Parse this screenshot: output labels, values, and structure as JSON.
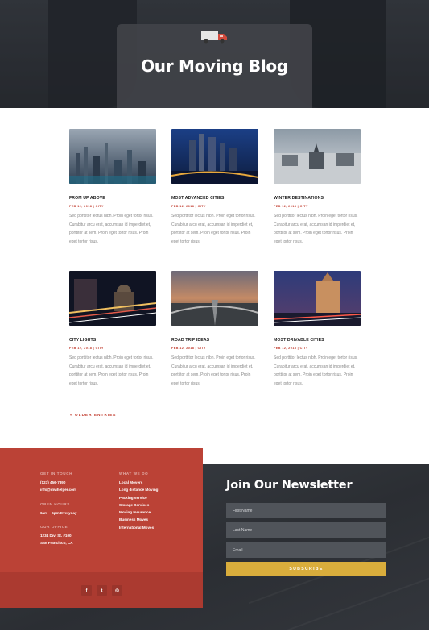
{
  "hero": {
    "title": "Our Moving Blog",
    "icon": "truck-icon"
  },
  "posts": [
    {
      "title": "FROM UP ABOVE",
      "meta": "FEB 12, 2018 | CITY",
      "excerpt": "Sed porttitor lectus nibh. Proin eget tortor risus. Curabitur arcu erat, accumsan id imperdiet et, porttitor at sem. Proin eget tortor risus. Proin eget tortor risus."
    },
    {
      "title": "MOST ADVANCED CITIES",
      "meta": "FEB 12, 2018 | CITY",
      "excerpt": "Sed porttitor lectus nibh. Proin eget tortor risus. Curabitur arcu erat, accumsan id imperdiet et, porttitor at sem. Proin eget tortor risus. Proin eget tortor risus."
    },
    {
      "title": "WINTER DESTINATIONS",
      "meta": "FEB 12, 2018 | CITY",
      "excerpt": "Sed porttitor lectus nibh. Proin eget tortor risus. Curabitur arcu erat, accumsan id imperdiet et, porttitor at sem. Proin eget tortor risus. Proin eget tortor risus."
    },
    {
      "title": "CITY LIGHTS",
      "meta": "FEB 12, 2018 | CITY",
      "excerpt": "Sed porttitor lectus nibh. Proin eget tortor risus. Curabitur arcu erat, accumsan id imperdiet et, porttitor at sem. Proin eget tortor risus. Proin eget tortor risus."
    },
    {
      "title": "ROAD TRIP IDEAS",
      "meta": "FEB 12, 2018 | CITY",
      "excerpt": "Sed porttitor lectus nibh. Proin eget tortor risus. Curabitur arcu erat, accumsan id imperdiet et, porttitor at sem. Proin eget tortor risus. Proin eget tortor risus."
    },
    {
      "title": "MOST DRIVABLE CITIES",
      "meta": "FEB 12, 2018 | CITY",
      "excerpt": "Sed porttitor lectus nibh. Proin eget tortor risus. Curabitur arcu erat, accumsan id imperdiet et, porttitor at sem. Proin eget tortor risus. Proin eget tortor risus."
    }
  ],
  "pagination": {
    "older_label": "« OLDER ENTRIES"
  },
  "footer": {
    "contact": {
      "heading": "GET IN TOUCH",
      "phone": "(123) 456-7890",
      "email": "info@divihelper.com"
    },
    "hours": {
      "heading": "OPEN HOURS",
      "value": "6am – 5pm Everyday"
    },
    "office": {
      "heading": "OUR OFFICE",
      "line1": "1234 Divi St. #100",
      "line2": "San Francisco, CA"
    },
    "services": {
      "heading": "WHAT WE DO",
      "items": [
        "Local Movers",
        "Long distance Moving",
        "Packing service",
        "Storage Services",
        "Moving Insurance",
        "Business Moves",
        "International Moves"
      ]
    },
    "social": {
      "facebook": "f",
      "twitter": "t",
      "instagram": "◎"
    }
  },
  "newsletter": {
    "title": "Join Our Newsletter",
    "first_name": "First Name",
    "last_name": "Last Name",
    "email": "Email",
    "subscribe_label": "SUBSCRIBE"
  },
  "colors": {
    "accent": "#bb4236",
    "button": "#d9ad3c",
    "dark": "#2b2e33"
  }
}
